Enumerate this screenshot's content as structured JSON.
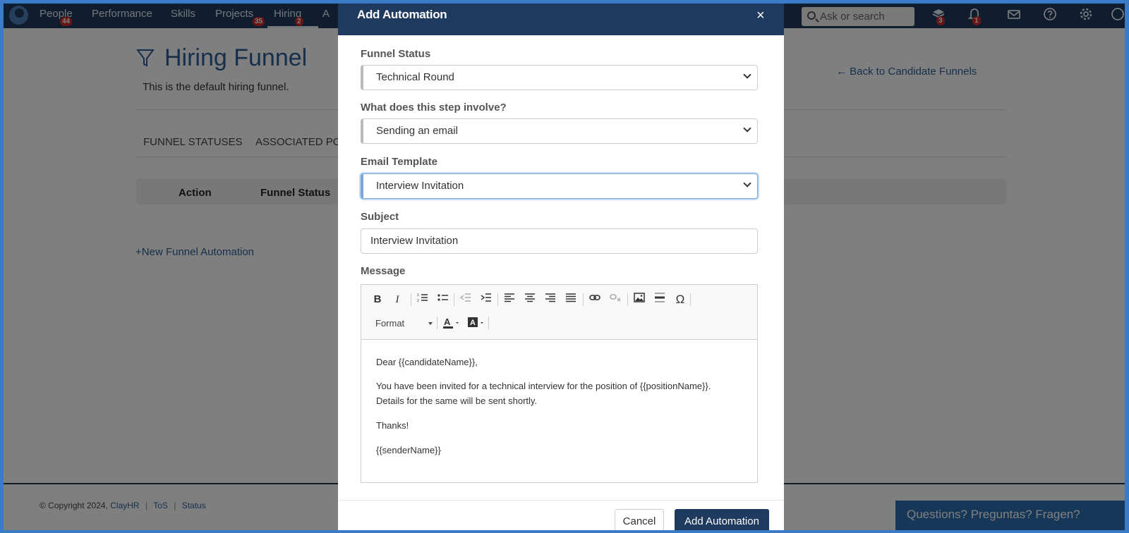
{
  "nav": {
    "items": [
      {
        "label": "People",
        "badge": "44"
      },
      {
        "label": "Performance"
      },
      {
        "label": "Skills"
      },
      {
        "label": "Projects",
        "badge": "35"
      },
      {
        "label": "Hiring",
        "badge": "2"
      },
      {
        "label": "A"
      }
    ],
    "search_placeholder": "Ask or search",
    "icon_badges": {
      "layers": "3",
      "bell": "1"
    }
  },
  "page": {
    "title": "Hiring Funnel",
    "description": "This is the default hiring funnel.",
    "back_link": "Back to Candidate Funnels",
    "tabs": [
      "FUNNEL STATUSES",
      "ASSOCIATED PO"
    ],
    "table_headers": [
      "Action",
      "Funnel Status"
    ],
    "new_link": "New Funnel Automation"
  },
  "footer": {
    "copyright": "© Copyright 2024,",
    "company": "ClayHR",
    "tos": "ToS",
    "status": "Status",
    "sep": "|"
  },
  "chat": {
    "label": "Questions? Preguntas? Fragen?"
  },
  "modal": {
    "title": "Add Automation",
    "close": "×",
    "funnel_status": {
      "label": "Funnel Status",
      "value": "Technical Round"
    },
    "step": {
      "label": "What does this step involve?",
      "value": "Sending an email"
    },
    "template": {
      "label": "Email Template",
      "value": "Interview Invitation"
    },
    "subject": {
      "label": "Subject",
      "value": "Interview Invitation"
    },
    "message": {
      "label": "Message",
      "format_label": "Format",
      "lines": [
        "Dear {{candidateName}},",
        "You have been invited for a technical interview for the position of {{positionName}}.",
        "Details for the same will be sent shortly.",
        "Thanks!",
        "{{senderName}}"
      ]
    },
    "cancel": "Cancel",
    "submit": "Add Automation"
  },
  "colors": {
    "brand": "#1e3a5f",
    "link": "#2d6096",
    "badge": "#d42b2b"
  }
}
